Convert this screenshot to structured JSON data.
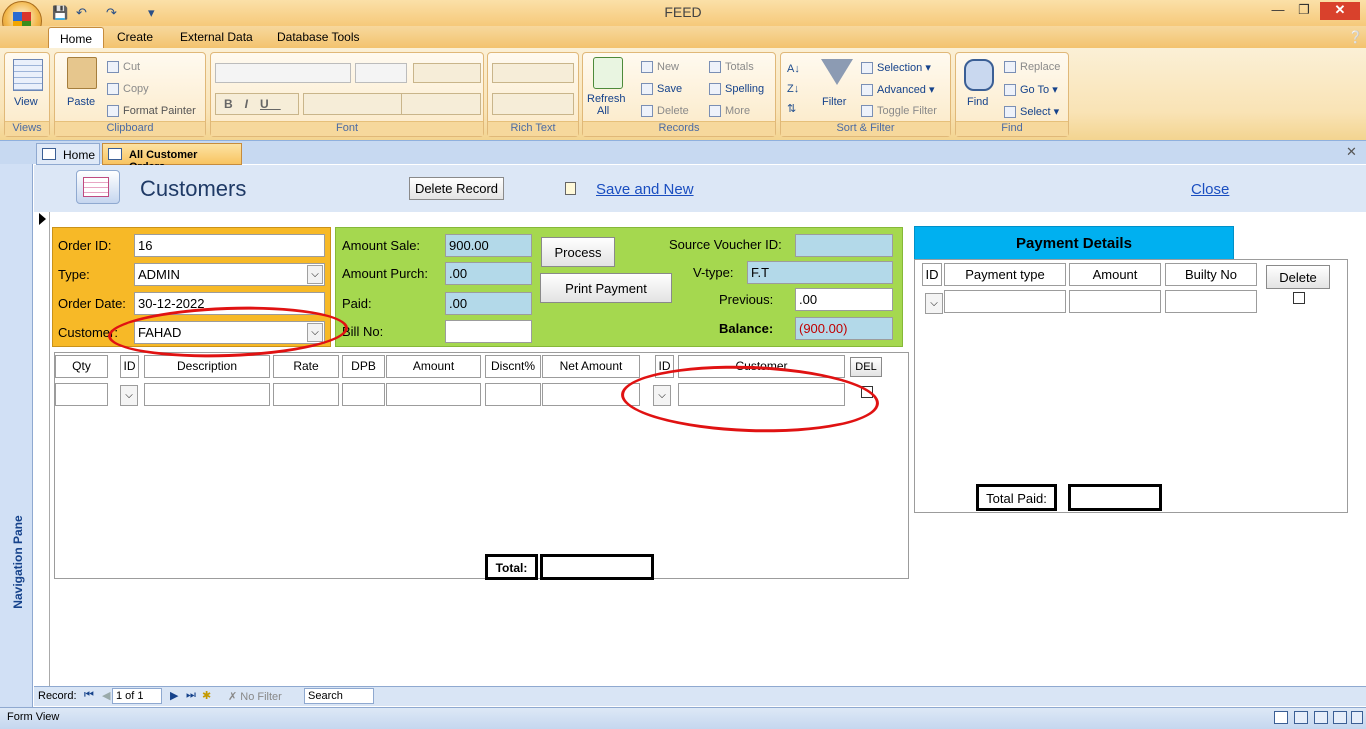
{
  "window": {
    "title": "FEED"
  },
  "ribbon_tabs": [
    "Home",
    "Create",
    "External Data",
    "Database Tools"
  ],
  "ribbon": {
    "views": {
      "view_label": "View",
      "group_label": "Views"
    },
    "clipboard": {
      "paste_label": "Paste",
      "cut_label": "Cut",
      "copy_label": "Copy",
      "format_painter_label": "Format Painter",
      "group_label": "Clipboard"
    },
    "font": {
      "group_label": "Font"
    },
    "rich_text": {
      "group_label": "Rich Text"
    },
    "records": {
      "refresh_label": "Refresh",
      "refresh_label2": "All",
      "new_label": "New",
      "save_label": "Save",
      "delete_label": "Delete",
      "totals_label": "Totals",
      "spelling_label": "Spelling",
      "more_label": "More",
      "group_label": "Records"
    },
    "sort_filter": {
      "filter_label": "Filter",
      "selection_label": "Selection",
      "advanced_label": "Advanced",
      "toggle_filter_label": "Toggle Filter",
      "group_label": "Sort & Filter"
    },
    "find": {
      "find_label": "Find",
      "replace_label": "Replace",
      "goto_label": "Go To",
      "select_label": "Select",
      "group_label": "Find"
    }
  },
  "document_tabs": [
    "Home",
    "All Customer Orders"
  ],
  "nav_pane_label": "Navigation Pane",
  "form": {
    "title": "Customers",
    "delete_record_label": "Delete Record",
    "save_and_new_label": "Save and New",
    "close_label": "Close",
    "order": {
      "order_id_label": "Order ID:",
      "order_id": "16",
      "type_label": "Type:",
      "type": "ADMIN",
      "order_date_label": "Order Date:",
      "order_date": "30-12-2022",
      "customer_label": "Customer:",
      "customer": "FAHAD"
    },
    "amounts": {
      "amount_sale_label": "Amount Sale:",
      "amount_sale": "900.00",
      "amount_purch_label": "Amount Purch:",
      "amount_purch": ".00",
      "paid_label": "Paid:",
      "paid": ".00",
      "bill_no_label": "Bill No:",
      "bill_no": "",
      "process_label": "Process",
      "print_payment_label": "Print Payment",
      "source_voucher_label": "Source Voucher ID:",
      "source_voucher": "",
      "vtype_label": "V-type:",
      "vtype": "F.T",
      "previous_label": "Previous:",
      "previous": ".00",
      "balance_label": "Balance:",
      "balance": "(900.00)"
    },
    "items_columns": [
      "Qty",
      "ID",
      "Description",
      "Rate",
      "DPB",
      "Amount",
      "Discnt%",
      "Net Amount",
      "ID",
      "Customer",
      "DEL"
    ],
    "items_total_label": "Total:",
    "payment": {
      "title": "Payment Details",
      "columns": [
        "ID",
        "Payment type",
        "Amount",
        "Builty No"
      ],
      "delete_label": "Delete",
      "total_paid_label": "Total Paid:"
    }
  },
  "record_nav": {
    "record_label": "Record:",
    "position": "1 of 1",
    "filter_label": "No Filter",
    "search_placeholder": "Search"
  },
  "status": {
    "view_label": "Form View"
  }
}
